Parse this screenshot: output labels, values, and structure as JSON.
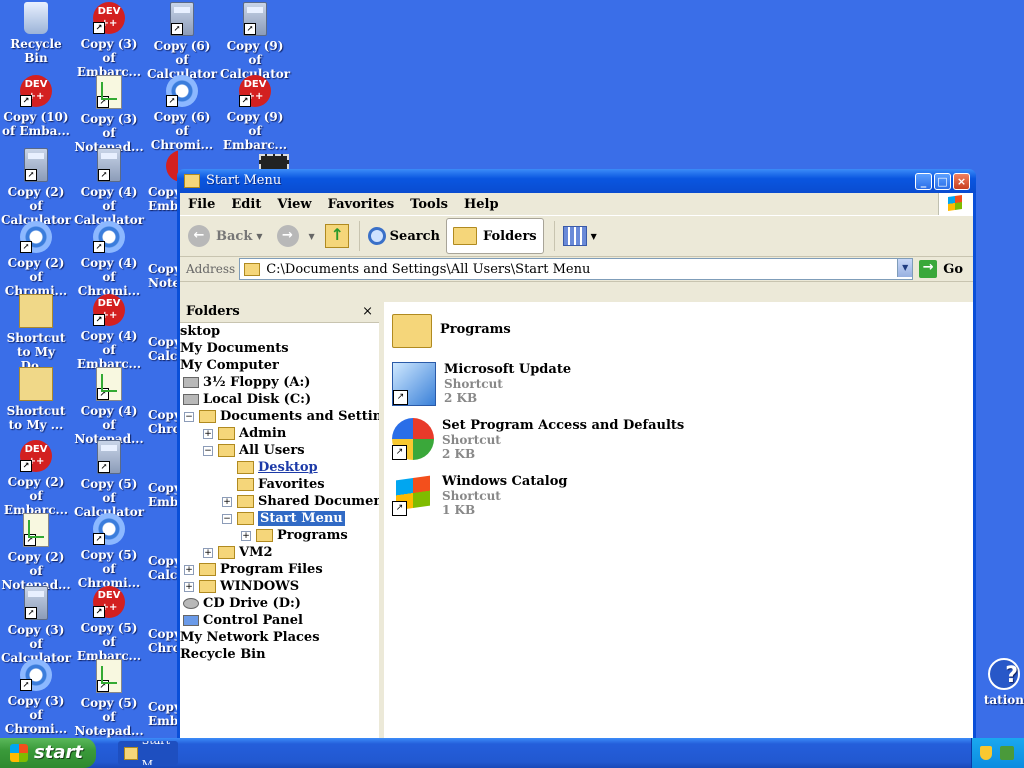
{
  "desktop": {
    "icons": [
      {
        "label": "Recycle Bin",
        "icon": "recycle-bin-icon"
      },
      {
        "label": "Copy (3) of Embarc...",
        "icon": "dev-cpp-icon"
      },
      {
        "label": "Copy (6) of Calculator",
        "icon": "calculator-icon"
      },
      {
        "label": "Copy (9) of Calculator",
        "icon": "calculator-icon"
      },
      {
        "label": "Copy (10) of Emba...",
        "icon": "dev-cpp-icon"
      },
      {
        "label": "Copy (3) of Notepad...",
        "icon": "notepad-icon"
      },
      {
        "label": "Copy (6) of Chromi...",
        "icon": "chromium-icon"
      },
      {
        "label": "Copy (9) of Embarc...",
        "icon": "dev-cpp-icon"
      },
      {
        "label": "Copy (2) of Calculator",
        "icon": "calculator-icon"
      },
      {
        "label": "Copy (4) of Calculator",
        "icon": "calculator-icon"
      },
      {
        "label": "Copy (2) of Chromi...",
        "icon": "chromium-icon"
      },
      {
        "label": "Copy (4) of Chromi...",
        "icon": "chromium-icon"
      },
      {
        "label": "Shortcut to My Do...",
        "icon": "shortcut-icon"
      },
      {
        "label": "Copy (4) of Embarc...",
        "icon": "dev-cpp-icon"
      },
      {
        "label": "Shortcut to My ...",
        "icon": "shortcut-icon"
      },
      {
        "label": "Copy (4) of Notepad...",
        "icon": "notepad-icon"
      },
      {
        "label": "Copy (2) of Embarc...",
        "icon": "dev-cpp-icon"
      },
      {
        "label": "Copy (5) of Calculator",
        "icon": "calculator-icon"
      },
      {
        "label": "Copy (2) of Notepad...",
        "icon": "notepad-icon"
      },
      {
        "label": "Copy (5) of Chromi...",
        "icon": "chromium-icon"
      },
      {
        "label": "Copy (3) of Calculator",
        "icon": "calculator-icon"
      },
      {
        "label": "Copy (5) of Embarc...",
        "icon": "dev-cpp-icon"
      },
      {
        "label": "Copy (3) of Chromi...",
        "icon": "chromium-icon"
      },
      {
        "label": "Copy (5) of Notepad...",
        "icon": "notepad-icon"
      }
    ],
    "partial": {
      "c3r3": "Copy",
      "c3r4": "Copy",
      "c3r5": "Copy",
      "c3r6": "Copy",
      "c3r7": "Copy",
      "c3r8": "Copy",
      "c3r9": "Copy",
      "c3r3b": "Emb",
      "c3r4b": "Note",
      "c3r5b": "Calc",
      "c3r6b": "Chro",
      "c3r7b": "Emb",
      "c3r8b": "Calc",
      "c3r9b": "Chro",
      "c3r10": "Copy",
      "c3r10b": "Emb",
      "help_label": "tation"
    }
  },
  "window": {
    "title": "Start Menu",
    "menu": [
      "File",
      "Edit",
      "View",
      "Favorites",
      "Tools",
      "Help"
    ],
    "toolbar": {
      "back": "Back",
      "search": "Search",
      "folders": "Folders"
    },
    "address": {
      "label": "Address",
      "path": "C:\\Documents and Settings\\All Users\\Start Menu",
      "go": "Go"
    },
    "folders_pane": {
      "title": "Folders",
      "close": "×",
      "tree": {
        "desktop": "sktop",
        "my_documents": "My Documents",
        "my_computer": "My Computer",
        "floppy": "3½ Floppy (A:)",
        "local_disk": "Local Disk (C:)",
        "docs_settings": "Documents and Settings",
        "admin": "Admin",
        "all_users": "All Users",
        "desktop_sub": "Desktop",
        "favorites": "Favorites",
        "shared_docs": "Shared Documents",
        "start_menu": "Start Menu",
        "programs": "Programs",
        "vm2": "VM2",
        "program_files": "Program Files",
        "windows": "WINDOWS",
        "cd_drive": "CD Drive (D:)",
        "control_panel": "Control Panel",
        "network": "My Network Places",
        "recycle": "Recycle Bin"
      }
    },
    "content": [
      {
        "name": "Programs",
        "type": "",
        "size": ""
      },
      {
        "name": "Microsoft Update",
        "type": "Shortcut",
        "size": "2 KB"
      },
      {
        "name": "Set Program Access and Defaults",
        "type": "Shortcut",
        "size": "2 KB"
      },
      {
        "name": "Windows Catalog",
        "type": "Shortcut",
        "size": "1 KB"
      }
    ]
  },
  "taskbar": {
    "start": "start",
    "item": "Start M"
  }
}
